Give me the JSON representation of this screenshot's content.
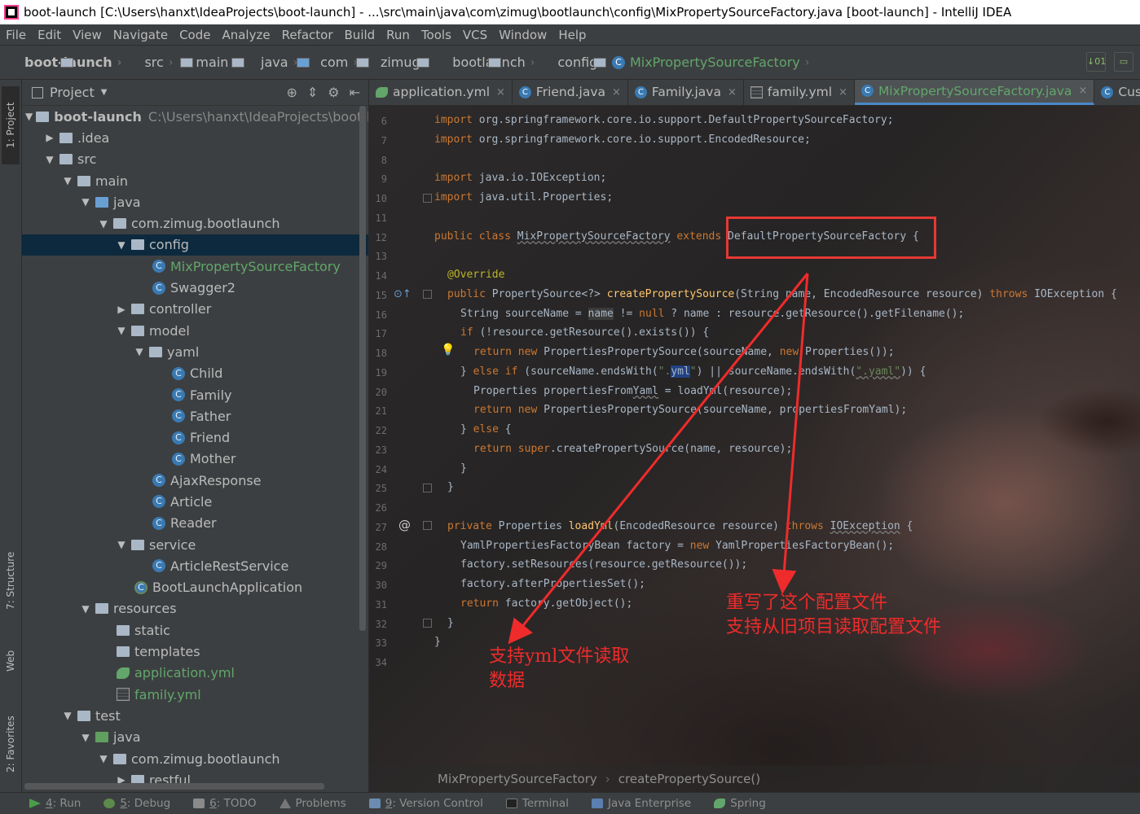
{
  "window": {
    "title": "boot-launch [C:\\Users\\hanxt\\IdeaProjects\\boot-launch] - ...\\src\\main\\java\\com\\zimug\\bootlaunch\\config\\MixPropertySourceFactory.java [boot-launch] - IntelliJ IDEA"
  },
  "menu": [
    "File",
    "Edit",
    "View",
    "Navigate",
    "Code",
    "Analyze",
    "Refactor",
    "Build",
    "Run",
    "Tools",
    "VCS",
    "Window",
    "Help"
  ],
  "breadcrumbs": [
    "boot-launch",
    "src",
    "main",
    "java",
    "com",
    "zimug",
    "bootlaunch",
    "config",
    "MixPropertySourceFactory"
  ],
  "side_tabs": {
    "project": "1: Project",
    "structure": "7: Structure",
    "web": "Web",
    "favorites": "2: Favorites"
  },
  "project_panel": {
    "title": "Project",
    "tree": [
      {
        "label": "boot-launch",
        "path": "C:\\Users\\hanxt\\IdeaProjects\\boot-launch"
      },
      {
        "label": ".idea"
      },
      {
        "label": "src"
      },
      {
        "label": "main"
      },
      {
        "label": "java"
      },
      {
        "label": "com.zimug.bootlaunch"
      },
      {
        "label": "config"
      },
      {
        "label": "MixPropertySourceFactory"
      },
      {
        "label": "Swagger2"
      },
      {
        "label": "controller"
      },
      {
        "label": "model"
      },
      {
        "label": "yaml"
      },
      {
        "label": "Child"
      },
      {
        "label": "Family"
      },
      {
        "label": "Father"
      },
      {
        "label": "Friend"
      },
      {
        "label": "Mother"
      },
      {
        "label": "AjaxResponse"
      },
      {
        "label": "Article"
      },
      {
        "label": "Reader"
      },
      {
        "label": "service"
      },
      {
        "label": "ArticleRestService"
      },
      {
        "label": "BootLaunchApplication"
      },
      {
        "label": "resources"
      },
      {
        "label": "static"
      },
      {
        "label": "templates"
      },
      {
        "label": "application.yml"
      },
      {
        "label": "family.yml"
      },
      {
        "label": "test"
      },
      {
        "label": "java"
      },
      {
        "label": "com.zimug.bootlaunch"
      },
      {
        "label": "restful"
      }
    ]
  },
  "tabs": [
    {
      "label": "application.yml"
    },
    {
      "label": "Friend.java"
    },
    {
      "label": "Family.java"
    },
    {
      "label": "family.yml"
    },
    {
      "label": "MixPropertySourceFactory.java"
    },
    {
      "label": "Cust"
    }
  ],
  "line_numbers": [
    "6",
    "7",
    "8",
    "9",
    "10",
    "11",
    "12",
    "13",
    "14",
    "15",
    "16",
    "17",
    "18",
    "19",
    "20",
    "21",
    "22",
    "23",
    "24",
    "25",
    "26",
    "27",
    "28",
    "29",
    "30",
    "31",
    "32",
    "33",
    "34"
  ],
  "code_lines": {
    "l6_a": "import ",
    "l6_b": "org.springframework.core.io.support.DefaultPropertySourceFactory;",
    "l7_a": "import ",
    "l7_b": "org.springframework.core.io.support.EncodedResource;",
    "l9_a": "import ",
    "l9_b": "java.io.IOException;",
    "l10_a": "import ",
    "l10_b": "java.util.Properties;",
    "l12_a": "public class ",
    "l12_b": "MixPropertySourceFactory",
    "l12_c": " extends ",
    "l12_d": "DefaultPropertySourceFactory {",
    "l14": "@Override",
    "l15_a": "public ",
    "l15_b": "PropertySource<?> ",
    "l15_c": "createPropertySource",
    "l15_d": "(String name, EncodedResource resource) ",
    "l15_e": "throws ",
    "l15_f": "IOException {",
    "l16_a": "String sourceName = ",
    "l16_b": "name",
    "l16_c": " != ",
    "l16_d": "null",
    "l16_e": " ? name : resource.getResource().getFilename();",
    "l17_a": "if ",
    "l17_b": "(!resource.getResource().exists()) {",
    "l18_a": "return new ",
    "l18_b": "PropertiesPropertySource(sourceName, ",
    "l18_c": "new ",
    "l18_d": "Properties());",
    "l19_a": "} ",
    "l19_b": "else if ",
    "l19_c": "(sourceName.endsWith(",
    "l19_d": "\".",
    "l19_e": "yml",
    "l19_f": "\"",
    "l19_g": ") || sourceName.endsWith(",
    "l19_h": "\".yaml\"",
    "l19_i": ")) {",
    "l20_a": "Properties propertiesFrom",
    "l20_b": "Yaml",
    "l20_c": " = loadYml(resource);",
    "l21_a": "return new ",
    "l21_b": "PropertiesPropertySource(sourceName, propertiesFromYaml);",
    "l22_a": "} ",
    "l22_b": "else ",
    "l22_c": "{",
    "l23_a": "return super",
    "l23_b": ".createPropertySource(name, resource);",
    "l24": "}",
    "l25": "}",
    "l27_a": "private ",
    "l27_b": "Properties ",
    "l27_c": "loadYml",
    "l27_d": "(EncodedResource resource) ",
    "l27_e": "throws ",
    "l27_f": "IOException",
    "l27_g": " {",
    "l28_a": "YamlPropertiesFactoryBean factory = ",
    "l28_b": "new ",
    "l28_c": "YamlPropertiesFactoryBean();",
    "l29": "factory.setResources(resource.getResource());",
    "l30": "factory.afterPropertiesSet();",
    "l31_a": "return ",
    "l31_b": "factory.getObject();",
    "l32": "}",
    "l33": "}"
  },
  "annotations": {
    "right_line1": "重写了这个配置文件",
    "right_line2": "支持从旧项目读取配置文件",
    "left_line1": "支持yml文件读取",
    "left_line2": "数据"
  },
  "editor_breadcrumb": [
    "MixPropertySourceFactory",
    "createPropertySource()"
  ],
  "bottom_tools": [
    {
      "num": "4",
      "label": ": Run"
    },
    {
      "num": "5",
      "label": ": Debug"
    },
    {
      "num": "6",
      "label": ": TODO"
    },
    {
      "num": "",
      "label": "Problems"
    },
    {
      "num": "9",
      "label": ": Version Control"
    },
    {
      "num": "",
      "label": "Terminal"
    },
    {
      "num": "",
      "label": "Java Enterprise"
    },
    {
      "num": "",
      "label": "Spring"
    }
  ],
  "colors": {
    "keyword": "#cc7832",
    "annotation_red": "#ef2b2b",
    "class_green": "#62a66b",
    "function": "#ffc66d"
  }
}
